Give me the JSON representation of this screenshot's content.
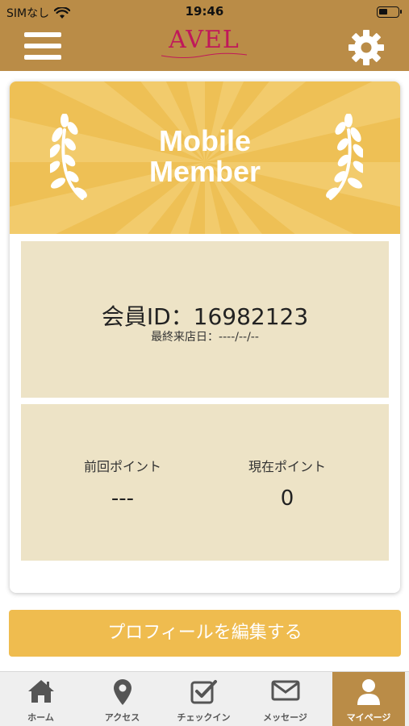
{
  "status_bar": {
    "carrier": "SIMなし",
    "time": "19:46",
    "battery_level": 0.45
  },
  "header": {
    "logo_text": "AVEL",
    "menu_icon": "hamburger-menu-icon",
    "settings_icon": "gear-icon"
  },
  "card": {
    "banner_title_line1": "Mobile",
    "banner_title_line2": "Member",
    "member_id_label": "会員ID：16982123",
    "last_visit_label": "最終来店日：----/--/--",
    "previous_points_label": "前回ポイント",
    "previous_points_value": "---",
    "current_points_label": "現在ポイント",
    "current_points_value": "0"
  },
  "edit_profile_button": "プロフィールを編集する",
  "tabs": [
    {
      "label": "ホーム",
      "icon": "home-icon",
      "active": false
    },
    {
      "label": "アクセス",
      "icon": "map-pin-icon",
      "active": false
    },
    {
      "label": "チェックイン",
      "icon": "checkbox-icon",
      "active": false
    },
    {
      "label": "メッセージ",
      "icon": "envelope-icon",
      "active": false
    },
    {
      "label": "マイページ",
      "icon": "user-icon",
      "active": true
    }
  ],
  "colors": {
    "header_brown": "#ba8c47",
    "banner_yellow": "#eec055",
    "panel_beige": "#ede3c6",
    "button_yellow": "#efbc4f",
    "logo_pink": "#c0185a"
  }
}
